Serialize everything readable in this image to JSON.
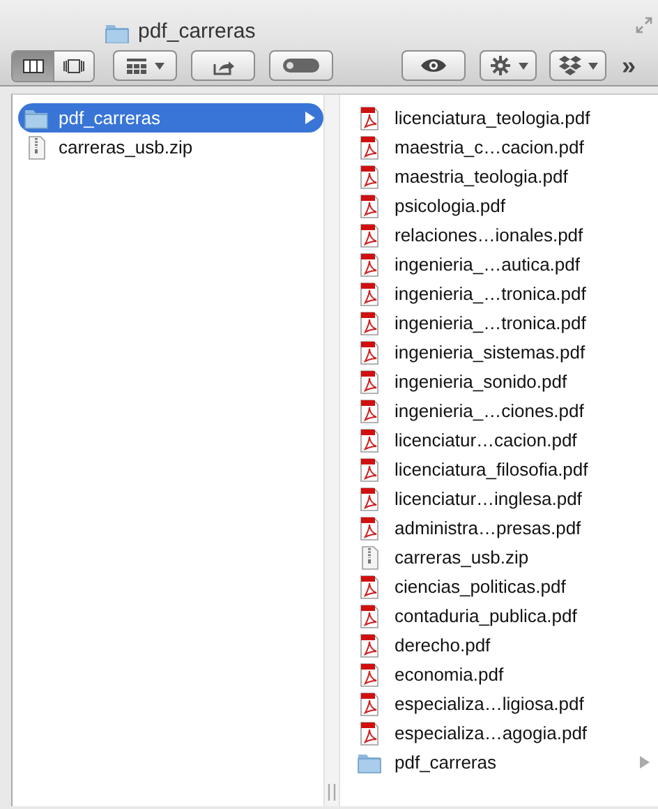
{
  "window": {
    "title": "pdf_carreras"
  },
  "toolbar": {
    "view_modes": [
      {
        "kind": "columns",
        "selected": true
      },
      {
        "kind": "coverflow",
        "selected": false
      }
    ],
    "buttons": [
      {
        "kind": "arrange",
        "dropdown": true
      },
      {
        "kind": "share",
        "dropdown": false
      },
      {
        "kind": "toggle",
        "dropdown": false
      },
      {
        "kind": "quicklook",
        "dropdown": false
      },
      {
        "kind": "action",
        "dropdown": true
      },
      {
        "kind": "dropbox",
        "dropdown": true
      }
    ],
    "overflow": "»"
  },
  "columns": [
    {
      "items": [
        {
          "name": "pdf_carreras",
          "kind": "folder",
          "selected": true
        },
        {
          "name": "carreras_usb.zip",
          "kind": "zip",
          "selected": false
        }
      ]
    },
    {
      "items": [
        {
          "name": "licenciatura_teologia.pdf",
          "kind": "pdf",
          "selected": false
        },
        {
          "name": "maestria_c…cacion.pdf",
          "kind": "pdf",
          "selected": false
        },
        {
          "name": "maestria_teologia.pdf",
          "kind": "pdf",
          "selected": false
        },
        {
          "name": "psicologia.pdf",
          "kind": "pdf",
          "selected": false
        },
        {
          "name": "relaciones…ionales.pdf",
          "kind": "pdf",
          "selected": false
        },
        {
          "name": "ingenieria_…autica.pdf",
          "kind": "pdf",
          "selected": false
        },
        {
          "name": "ingenieria_…tronica.pdf",
          "kind": "pdf",
          "selected": false
        },
        {
          "name": "ingenieria_…tronica.pdf",
          "kind": "pdf",
          "selected": false
        },
        {
          "name": "ingenieria_sistemas.pdf",
          "kind": "pdf",
          "selected": false
        },
        {
          "name": "ingenieria_sonido.pdf",
          "kind": "pdf",
          "selected": false
        },
        {
          "name": "ingenieria_…ciones.pdf",
          "kind": "pdf",
          "selected": false
        },
        {
          "name": "licenciatur…cacion.pdf",
          "kind": "pdf",
          "selected": false
        },
        {
          "name": "licenciatura_filosofia.pdf",
          "kind": "pdf",
          "selected": false
        },
        {
          "name": "licenciatur…inglesa.pdf",
          "kind": "pdf",
          "selected": false
        },
        {
          "name": "administra…presas.pdf",
          "kind": "pdf",
          "selected": false
        },
        {
          "name": "carreras_usb.zip",
          "kind": "zip",
          "selected": false
        },
        {
          "name": "ciencias_politicas.pdf",
          "kind": "pdf",
          "selected": false
        },
        {
          "name": "contaduria_publica.pdf",
          "kind": "pdf",
          "selected": false
        },
        {
          "name": "derecho.pdf",
          "kind": "pdf",
          "selected": false
        },
        {
          "name": "economia.pdf",
          "kind": "pdf",
          "selected": false
        },
        {
          "name": "especializa…ligiosa.pdf",
          "kind": "pdf",
          "selected": false
        },
        {
          "name": "especializa…agogia.pdf",
          "kind": "pdf",
          "selected": false
        },
        {
          "name": "pdf_carreras",
          "kind": "folder",
          "selected": false
        }
      ]
    }
  ]
}
